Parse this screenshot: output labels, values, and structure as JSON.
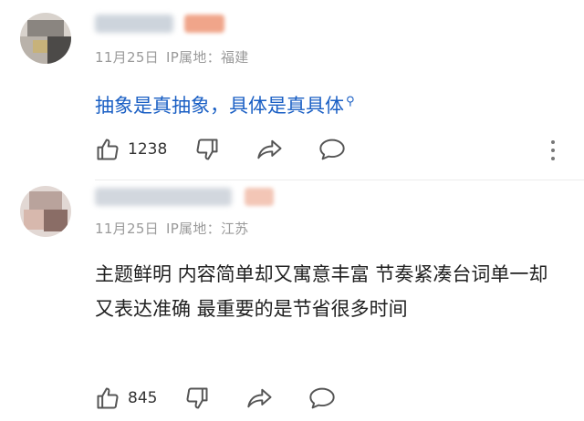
{
  "comments": [
    {
      "date": "11月25日",
      "location": "IP属地：福建",
      "text": "抽象是真抽象，具体是真具体",
      "text_style": "search-link",
      "likes": "1238"
    },
    {
      "date": "11月25日",
      "location": "IP属地：江苏",
      "text": "主题鲜明 内容简单却又寓意丰富 节奏紧凑台词单一却又表达准确 最重要的是节省很多时间",
      "text_style": "plain",
      "likes": "845"
    }
  ],
  "colors": {
    "link": "#1a5fc4",
    "meta": "#9a9a9a",
    "icon": "#555555"
  },
  "icons": [
    "thumbs-up-icon",
    "thumbs-down-icon",
    "share-icon",
    "reply-icon",
    "more-icon",
    "search-icon"
  ]
}
